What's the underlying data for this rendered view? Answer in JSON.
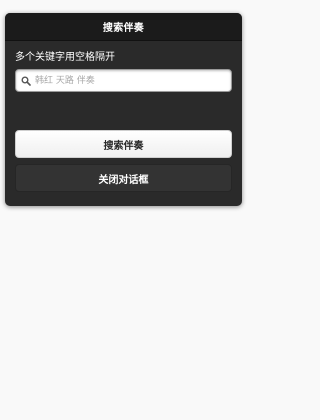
{
  "dialog": {
    "title": "搜索伴奏",
    "hint": "多个关键字用空格隔开",
    "search": {
      "placeholder": "韩红 天路 伴奏",
      "value": ""
    },
    "search_button_label": "搜索伴奏",
    "close_button_label": "关闭对话框"
  },
  "icons": {
    "search": "search-icon"
  },
  "colors": {
    "page_background": "#f9f9f9",
    "dialog_background": "#2a2a2a",
    "header_background": "#1b1b1b",
    "primary_button": "#f4f4f4",
    "secondary_button": "#333333"
  }
}
